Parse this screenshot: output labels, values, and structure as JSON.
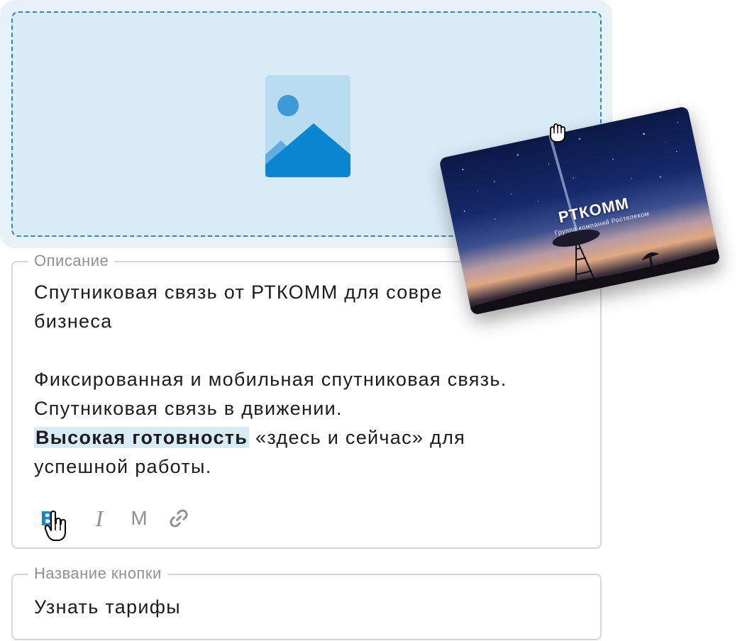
{
  "upload": {
    "placeholder_icon": "image-placeholder-icon",
    "accent": "#2a88c3"
  },
  "description": {
    "legend": "Описание",
    "line1": "Спутниковая связь от РТКОММ для совре",
    "line2": "бизнеса",
    "line3": "Фиксированная и мобильная спутниковая связь.",
    "line4": "Спутниковая связь в движении.",
    "line5_bold": "Высокая готовность",
    "line5_rest": " «здесь и сейчас» для",
    "line6": "успешной работы."
  },
  "toolbar": {
    "bold": "B",
    "italic": "I",
    "mono": "M",
    "link_icon": "link-icon"
  },
  "button_field": {
    "legend": "Название кнопки",
    "value": "Узнать тарифы"
  },
  "drag_image": {
    "logo": "РТКОММ",
    "subtitle": "Группа компаний Ростелеком"
  },
  "colors": {
    "accent": "#1a86c8",
    "highlight": "#d9ebf6",
    "border": "#d4d6d9",
    "legend": "#8e9196"
  }
}
